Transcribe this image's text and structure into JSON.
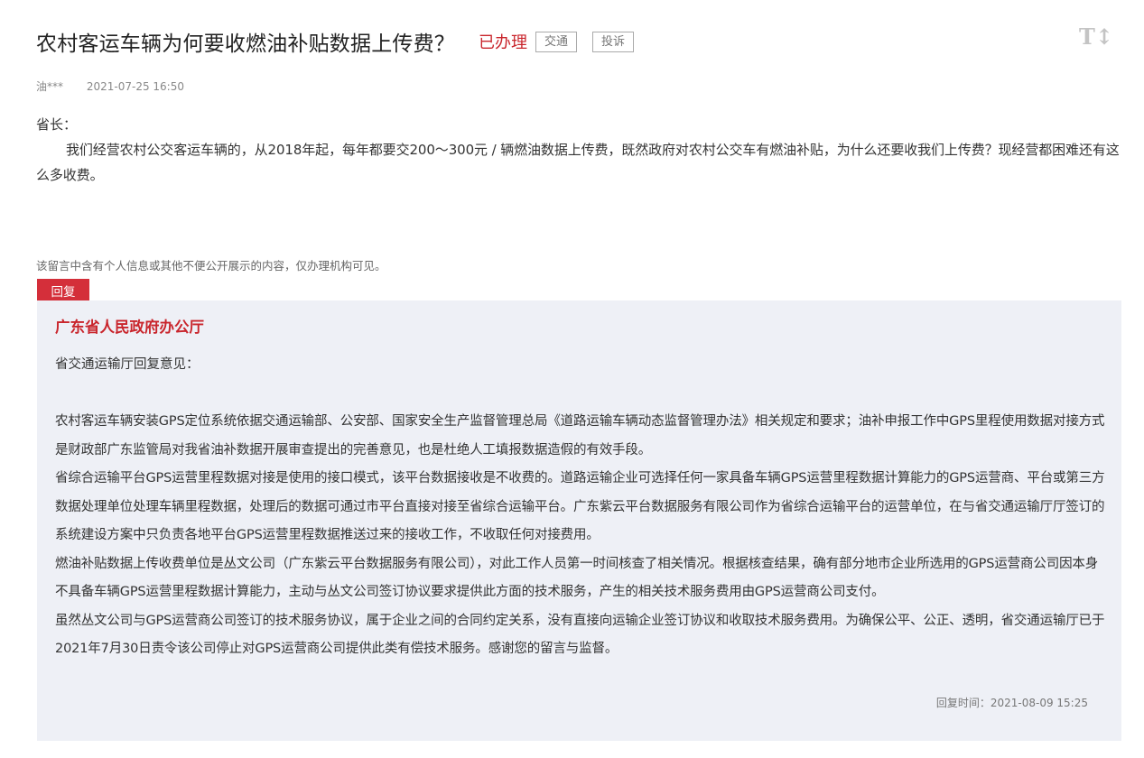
{
  "header": {
    "title": "农村客运车辆为何要收燃油补贴数据上传费？",
    "status": "已办理",
    "category_tag": "交通",
    "complaint_button": "投诉",
    "font_toggle_label": "T↕",
    "font_toggle_icon": "font-size-icon"
  },
  "meta": {
    "author": "油***",
    "date": "2021-07-25 16:50"
  },
  "question": {
    "salutation": "省长：",
    "body": "我们经营农村公交客运车辆的，从2018年起，每年都要交200～300元 / 辆燃油数据上传费，既然政府对农村公交车有燃油补贴，为什么还要收我们上传费？现经营都困难还有这么多收费。"
  },
  "privacy_notice": "该留言中含有个人信息或其他不便公开展示的内容，仅办理机构可见。",
  "reply": {
    "tab_label": "回复",
    "org": "广东省人民政府办公厅",
    "intro": "省交通运输厅回复意见：",
    "paragraphs": [
      "农村客运车辆安装GPS定位系统依据交通运输部、公安部、国家安全生产监督管理总局《道路运输车辆动态监督管理办法》相关规定和要求；油补申报工作中GPS里程使用数据对接方式是财政部广东监管局对我省油补数据开展审查提出的完善意见，也是杜绝人工填报数据造假的有效手段。",
      "省综合运输平台GPS运营里程数据对接是使用的接口模式，该平台数据接收是不收费的。道路运输企业可选择任何一家具备车辆GPS运营里程数据计算能力的GPS运营商、平台或第三方数据处理单位处理车辆里程数据，处理后的数据可通过市平台直接对接至省综合运输平台。广东紫云平台数据服务有限公司作为省综合运输平台的运营单位，在与省交通运输厅厅签订的系统建设方案中只负责各地平台GPS运营里程数据推送过来的接收工作，不收取任何对接费用。",
      "燃油补贴数据上传收费单位是丛文公司（广东紫云平台数据服务有限公司），对此工作人员第一时间核查了相关情况。根据核查结果，确有部分地市企业所选用的GPS运营商公司因本身不具备车辆GPS运营里程数据计算能力，主动与丛文公司签订协议要求提供此方面的技术服务，产生的相关技术服务费用由GPS运营商公司支付。",
      "虽然丛文公司与GPS运营商公司签订的技术服务协议，属于企业之间的合同约定关系，没有直接向运输企业签订协议和收取技术服务费用。为确保公平、公正、透明，省交通运输厅已于2021年7月30日责令该公司停止对GPS运营商公司提供此类有偿技术服务。感谢您的留言与监督。"
    ],
    "reply_time_label": "回复时间：",
    "reply_time": "2021-08-09 15:25"
  },
  "colors": {
    "accent_red": "#c9252c",
    "tab_red": "#d42f3a",
    "reply_bg": "#eef0f6"
  }
}
